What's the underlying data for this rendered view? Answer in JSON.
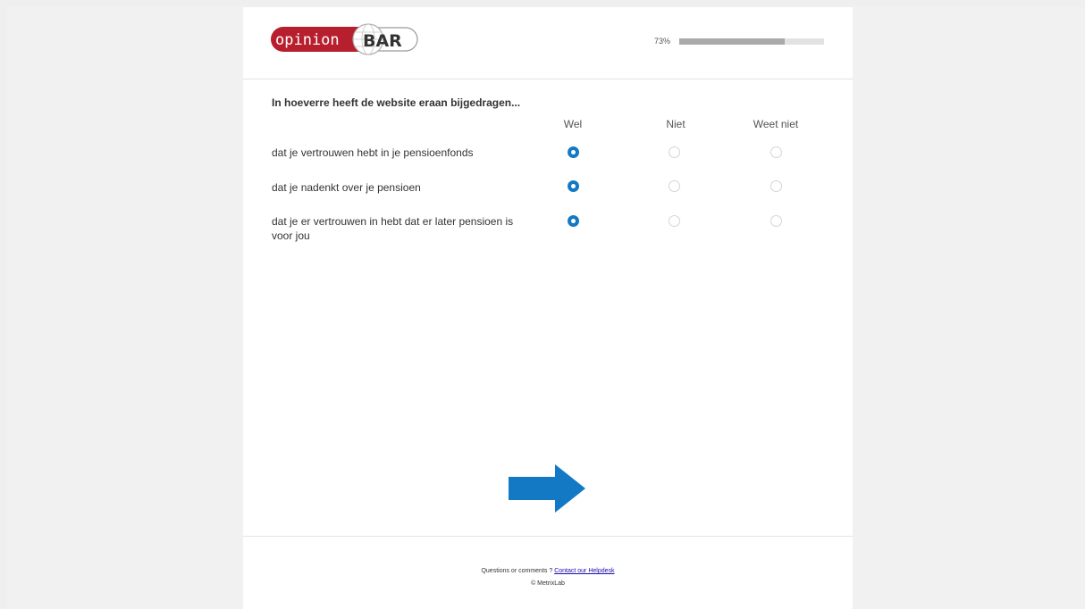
{
  "header": {
    "logo": {
      "left": "opinion",
      "right": "BAR"
    },
    "progress": {
      "label": "73%",
      "fraction": 0.73
    }
  },
  "survey": {
    "question": "In hoeverre heeft de website eraan bijgedragen...",
    "columns": [
      "Wel",
      "Niet",
      "Weet niet"
    ],
    "rows": [
      {
        "label": "dat je vertrouwen hebt in je pensioenfonds",
        "selected": "Wel"
      },
      {
        "label": "dat je nadenkt over je pensioen",
        "selected": "Wel"
      },
      {
        "label": "dat je er vertrouwen in hebt dat er later pensioen is voor jou",
        "selected": "Wel"
      }
    ]
  },
  "next": {
    "icon": "arrow-right-icon",
    "color": "#1479c4"
  },
  "footer": {
    "text": "Questions or comments ?",
    "link": "Contact our Helpdesk",
    "copyright": "© MetrixLab"
  },
  "colors": {
    "brand_red": "#b81f2e",
    "accent_blue": "#1479c4"
  }
}
